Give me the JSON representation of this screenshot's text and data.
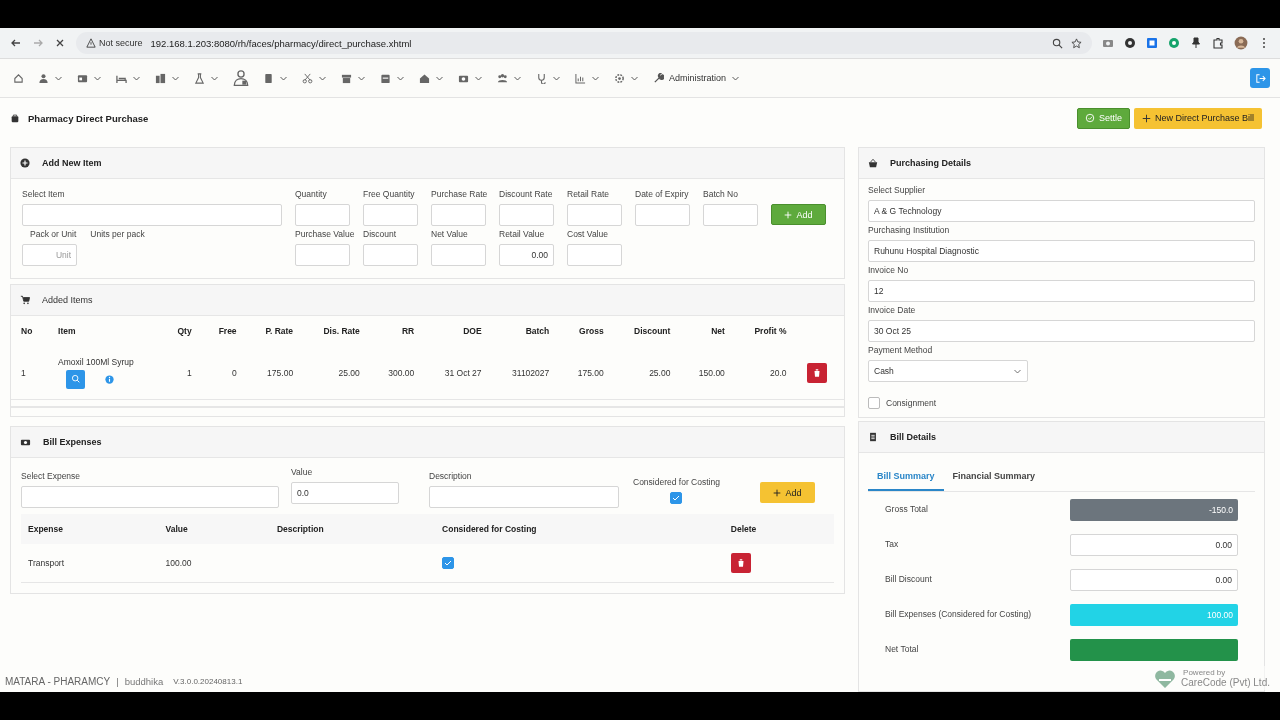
{
  "browser": {
    "security": "Not secure",
    "url": "192.168.1.203:8080/rh/faces/pharmacy/direct_purchase.xhtml"
  },
  "nav": {
    "menu": "Administration"
  },
  "page": {
    "title": "Pharmacy Direct Purchase",
    "buttons": [
      {
        "label": "Settle",
        "kind": "success"
      },
      {
        "label": "New Direct Purchase Bill",
        "kind": "warning"
      }
    ]
  },
  "add_item": {
    "title": "Add New Item",
    "item_field": {
      "label": "Select Item"
    },
    "fields": [
      {
        "label": "Quantity"
      },
      {
        "label": "Free Quantity"
      },
      {
        "label": "Purchase Rate"
      },
      {
        "label": "Discount Rate"
      },
      {
        "label": "Retail Rate"
      },
      {
        "label": "Date of Expiry"
      },
      {
        "label": "Batch No"
      }
    ],
    "add_button": "Add",
    "pack": {
      "label": "Pack or Unit",
      "placeholder": "Unit"
    },
    "units_label": "Units per pack",
    "value_fields": [
      {
        "label": "Purchase Value"
      },
      {
        "label": "Discount"
      },
      {
        "label": "Net Value"
      },
      {
        "label": "Retail Value",
        "value": "0.00"
      },
      {
        "label": "Cost Value"
      }
    ]
  },
  "added_items": {
    "title": "Added Items",
    "columns": [
      "No",
      "Item",
      "Qty",
      "Free",
      "P. Rate",
      "Dis. Rate",
      "RR",
      "DOE",
      "Batch",
      "Gross",
      "Discount",
      "Net",
      "Profit %"
    ],
    "rows": [
      {
        "no": "1",
        "item": "Amoxil 100Ml Syrup",
        "qty": "1",
        "free": "0",
        "p_rate": "175.00",
        "dis_rate": "25.00",
        "rr": "300.00",
        "doe": "31 Oct 27",
        "batch": "31102027",
        "gross": "175.00",
        "discount": "25.00",
        "net": "150.00",
        "profit": "20.0"
      }
    ]
  },
  "bill_expenses": {
    "title": "Bill Expenses",
    "expense_field": {
      "label": "Select Expense"
    },
    "value_field": {
      "label": "Value",
      "value": "0.0"
    },
    "description_field": {
      "label": "Description"
    },
    "costing": {
      "label": "Considered for Costing",
      "checked": true
    },
    "add_button": "Add",
    "columns": [
      "Expense",
      "Value",
      "Description",
      "Considered for Costing",
      "Delete"
    ],
    "rows": [
      {
        "expense": "Transport",
        "value": "100.00",
        "considered": true
      }
    ]
  },
  "purchasing": {
    "title": "Purchasing Details",
    "fields": [
      {
        "label": "Select Supplier",
        "value": "A & G Technology"
      },
      {
        "label": "Purchasing Institution",
        "value": "Ruhunu Hospital Diagnostic"
      },
      {
        "label": "Invoice No",
        "value": "12"
      },
      {
        "label": "Invoice Date",
        "value": "30 Oct 25"
      }
    ],
    "payment": {
      "label": "Payment Method",
      "value": "Cash"
    },
    "consignment": {
      "label": "Consignment",
      "checked": false
    }
  },
  "bill_details": {
    "title": "Bill Details",
    "tabs": [
      {
        "label": "Bill Summary",
        "selected": true
      },
      {
        "label": "Financial Summary",
        "selected": false
      }
    ],
    "rows": [
      {
        "label": "Gross Total",
        "value": "-150.0",
        "kind": "dark"
      },
      {
        "label": "Tax",
        "value": "0.00",
        "kind": "input"
      },
      {
        "label": "Bill Discount",
        "value": "0.00",
        "kind": "input"
      },
      {
        "label": "Bill Expenses (Considered for Costing)",
        "value": "100.00",
        "kind": "info"
      },
      {
        "label": "Net Total",
        "kind": "success"
      }
    ]
  },
  "footer": {
    "department": "MATARA - PHARAMCY",
    "separator": "|",
    "user": "buddhika",
    "version": "V.3.0.0.20240813.1"
  },
  "badge": {
    "line1": "Powered by",
    "line2": "CareCode (Pvt) Ltd."
  }
}
